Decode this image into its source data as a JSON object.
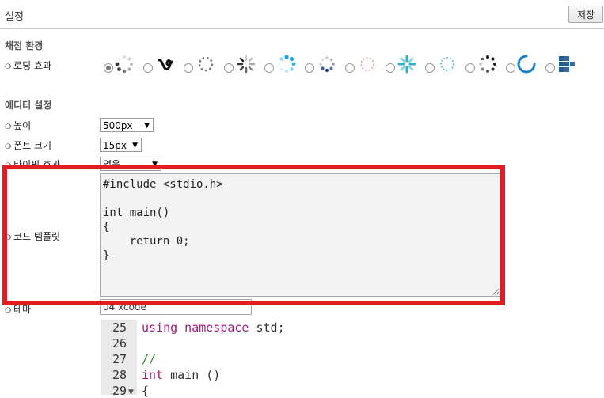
{
  "header": {
    "title": "설정",
    "save_label": "저장"
  },
  "grading": {
    "section_title": "채점 환경",
    "loading_label": "로딩 효과",
    "loading_options": [
      "dots-spinner",
      "swirl",
      "dashed-ring",
      "bars-spinner",
      "blue-dots",
      "dots-ring",
      "red-ring",
      "cyan-burst",
      "dots-circle",
      "black-dots",
      "blue-arc",
      "blue-squares"
    ],
    "selected_index": 0
  },
  "editor": {
    "section_title": "에디터 설정",
    "height_label": "높이",
    "height_value": "500px",
    "font_size_label": "폰트 크기",
    "font_size_value": "15px",
    "typing_label": "타이핑 효과",
    "typing_value": "없음",
    "template_label": "코드 템플릿",
    "template_code": "#include <stdio.h>\n\nint main()\n{\n    return 0;\n}",
    "theme_label": "테마",
    "theme_value": "04 xcode"
  },
  "preview": {
    "line_numbers": [
      "25",
      "26",
      "27",
      "28",
      "29"
    ],
    "lines": [
      "using namespace std;",
      "",
      "//",
      "int main ()",
      "{"
    ]
  },
  "colors": {
    "highlight": "#e31b23",
    "keyword": "#a0197e",
    "comment": "#2d8c2d"
  }
}
